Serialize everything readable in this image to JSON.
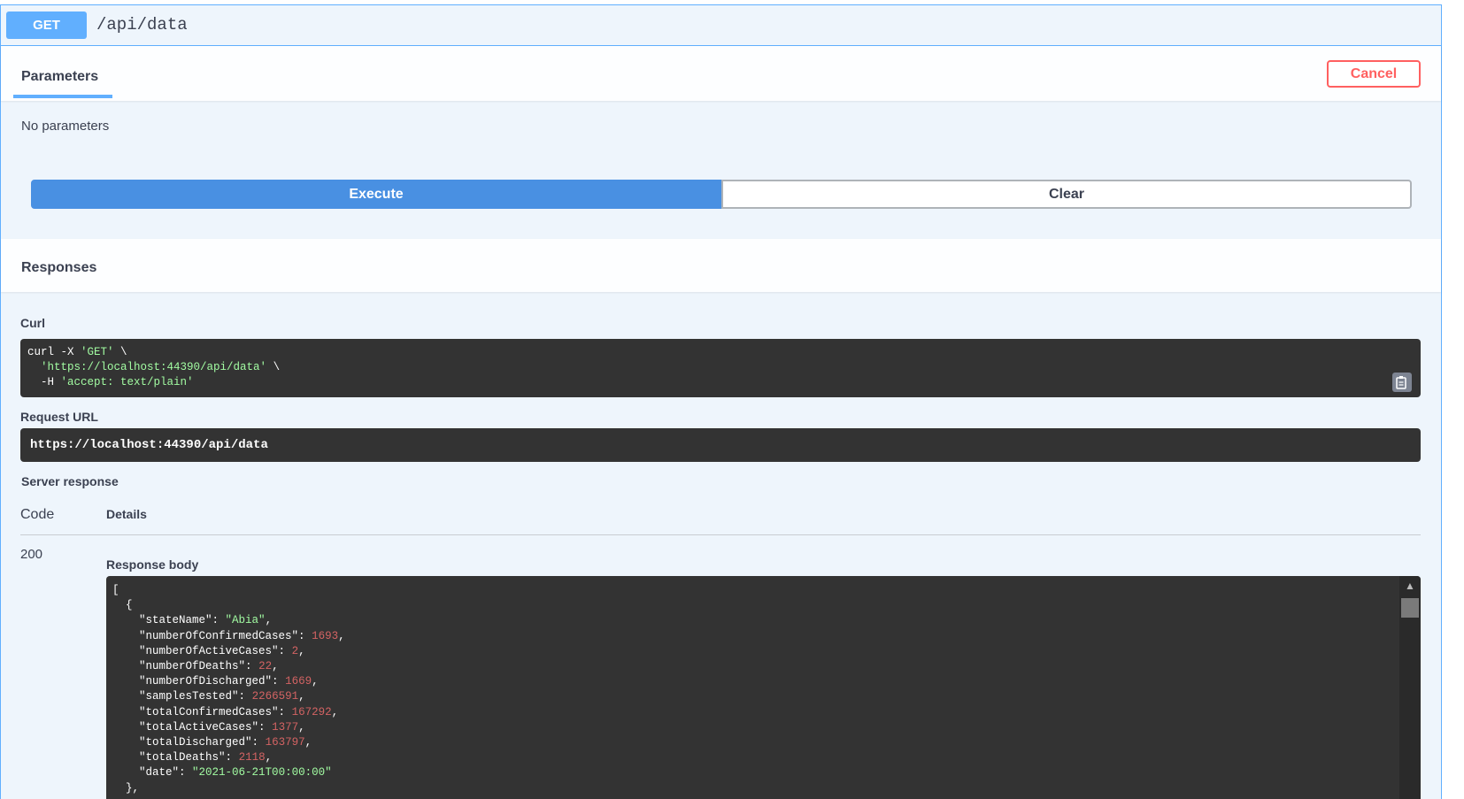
{
  "endpoint": {
    "method": "GET",
    "path": "/api/data"
  },
  "parameters": {
    "tab_label": "Parameters",
    "cancel_label": "Cancel",
    "empty_text": "No parameters"
  },
  "actions": {
    "execute_label": "Execute",
    "clear_label": "Clear"
  },
  "responses": {
    "title": "Responses",
    "curl_label": "Curl",
    "curl": {
      "line1_cmd": "curl -X ",
      "line1_method": "'GET'",
      "line1_end": " \\",
      "line2_url": "'https://localhost:44390/api/data'",
      "line2_end": " \\",
      "line3_flag": "  -H ",
      "line3_header": "'accept: text/plain'"
    },
    "request_url_label": "Request URL",
    "request_url": "https://localhost:44390/api/data",
    "server_response_label": "Server response",
    "code_header": "Code",
    "details_header": "Details",
    "status_code": "200",
    "response_body_label": "Response body",
    "body": {
      "open_bracket": "[",
      "open_brace": "  {",
      "fields": [
        {
          "key": "\"stateName\"",
          "value": "\"Abia\"",
          "type": "str"
        },
        {
          "key": "\"numberOfConfirmedCases\"",
          "value": "1693",
          "type": "num"
        },
        {
          "key": "\"numberOfActiveCases\"",
          "value": "2",
          "type": "num"
        },
        {
          "key": "\"numberOfDeaths\"",
          "value": "22",
          "type": "num"
        },
        {
          "key": "\"numberOfDischarged\"",
          "value": "1669",
          "type": "num"
        },
        {
          "key": "\"samplesTested\"",
          "value": "2266591",
          "type": "num"
        },
        {
          "key": "\"totalConfirmedCases\"",
          "value": "167292",
          "type": "num"
        },
        {
          "key": "\"totalActiveCases\"",
          "value": "1377",
          "type": "num"
        },
        {
          "key": "\"totalDischarged\"",
          "value": "163797",
          "type": "num"
        },
        {
          "key": "\"totalDeaths\"",
          "value": "2118",
          "type": "num"
        },
        {
          "key": "\"date\"",
          "value": "\"2021-06-21T00:00:00\"",
          "type": "str"
        }
      ],
      "close_brace": "  },"
    }
  },
  "colors": {
    "method_get": "#61affe",
    "execute": "#4990e2",
    "cancel": "#ff6060",
    "code_bg": "#333333",
    "string_value": "#a2fca2",
    "number_value": "#d36363"
  },
  "icons": {
    "copy": "copy-clipboard-icon",
    "scroll_up": "chevron-up-icon"
  }
}
